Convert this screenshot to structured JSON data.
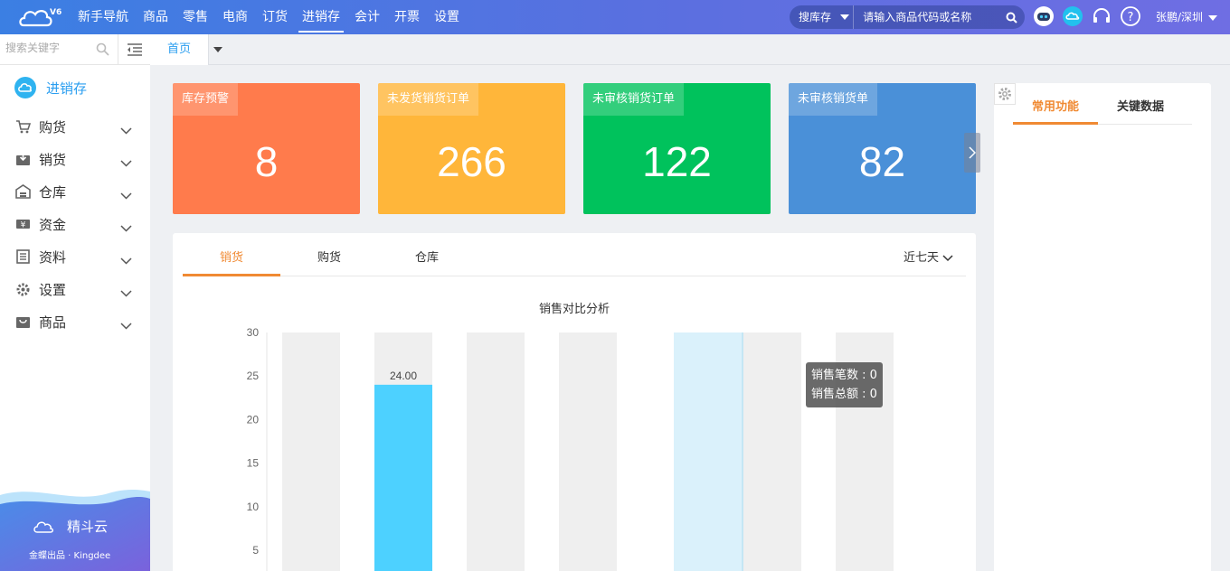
{
  "topbar": {
    "version": "V6",
    "nav": [
      "新手导航",
      "商品",
      "零售",
      "电商",
      "订货",
      "进销存",
      "会计",
      "开票",
      "设置"
    ],
    "active_nav": "进销存",
    "search_scope": "搜库存",
    "search_placeholder": "请输入商品代码或名称",
    "user": "张鹏/深圳"
  },
  "sidebar": {
    "search_placeholder": "搜索关键字",
    "module": "进销存",
    "items": [
      {
        "label": "购货",
        "icon": "cart-icon"
      },
      {
        "label": "销货",
        "icon": "sales-box-icon"
      },
      {
        "label": "仓库",
        "icon": "warehouse-icon"
      },
      {
        "label": "资金",
        "icon": "money-icon"
      },
      {
        "label": "资料",
        "icon": "document-list-icon"
      },
      {
        "label": "设置",
        "icon": "gear-icon"
      },
      {
        "label": "商品",
        "icon": "shop-bag-icon"
      }
    ],
    "brand": "精斗云",
    "brand_sub": "金蝶出品 · Kingdee"
  },
  "tabs": {
    "home": "首页"
  },
  "cards": [
    {
      "label": "库存预警",
      "value": "8",
      "color": "#ff7b4c"
    },
    {
      "label": "未发货销货订单",
      "value": "266",
      "color": "#ffb63a"
    },
    {
      "label": "未审核销货订单",
      "value": "122",
      "color": "#00c25c"
    },
    {
      "label": "未审核销货单",
      "value": "82",
      "color": "#4a90d8"
    }
  ],
  "panel": {
    "tabs": [
      "销货",
      "购货",
      "仓库"
    ],
    "active_tab": "销货",
    "range": "近七天",
    "chart_title": "销售对比分析",
    "tooltip": {
      "count": "销售笔数 : 0",
      "amount": "销售总额 : 0"
    }
  },
  "chart_data": {
    "type": "bar",
    "title": "销售对比分析",
    "yticks": [
      5,
      10,
      15,
      20,
      25,
      30
    ],
    "ylim": [
      0,
      30
    ],
    "categories_count": 7,
    "values": [
      0,
      24,
      0,
      0,
      0,
      0,
      0
    ],
    "data_labels": [
      "",
      "24.00",
      "",
      "",
      "",
      "",
      ""
    ],
    "highlight_index": 4,
    "bar_color": "#4dd1ff",
    "background_color": "#efefef",
    "grid": false
  },
  "right_panel": {
    "tabs": [
      "常用功能",
      "关键数据"
    ],
    "active_tab": "常用功能"
  },
  "colors": {
    "accent": "#2a9ef0",
    "orange": "#f08a33"
  }
}
